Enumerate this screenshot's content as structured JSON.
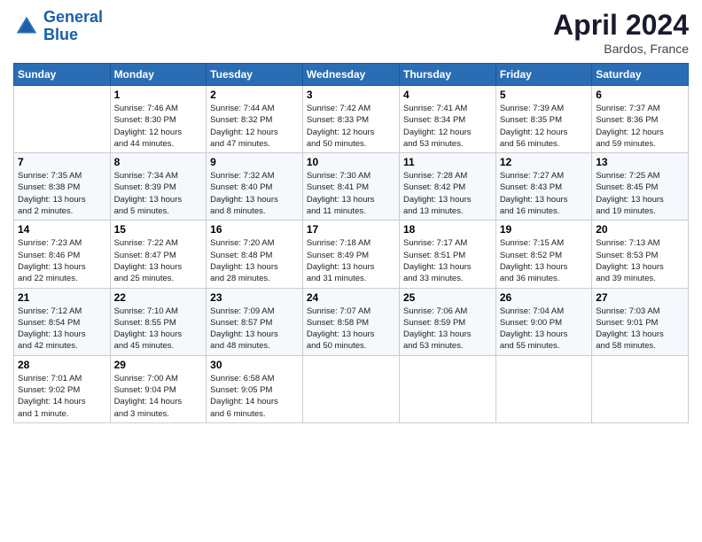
{
  "header": {
    "logo_line1": "General",
    "logo_line2": "Blue",
    "month": "April 2024",
    "location": "Bardos, France"
  },
  "days_of_week": [
    "Sunday",
    "Monday",
    "Tuesday",
    "Wednesday",
    "Thursday",
    "Friday",
    "Saturday"
  ],
  "weeks": [
    [
      {
        "num": "",
        "info": ""
      },
      {
        "num": "1",
        "info": "Sunrise: 7:46 AM\nSunset: 8:30 PM\nDaylight: 12 hours\nand 44 minutes."
      },
      {
        "num": "2",
        "info": "Sunrise: 7:44 AM\nSunset: 8:32 PM\nDaylight: 12 hours\nand 47 minutes."
      },
      {
        "num": "3",
        "info": "Sunrise: 7:42 AM\nSunset: 8:33 PM\nDaylight: 12 hours\nand 50 minutes."
      },
      {
        "num": "4",
        "info": "Sunrise: 7:41 AM\nSunset: 8:34 PM\nDaylight: 12 hours\nand 53 minutes."
      },
      {
        "num": "5",
        "info": "Sunrise: 7:39 AM\nSunset: 8:35 PM\nDaylight: 12 hours\nand 56 minutes."
      },
      {
        "num": "6",
        "info": "Sunrise: 7:37 AM\nSunset: 8:36 PM\nDaylight: 12 hours\nand 59 minutes."
      }
    ],
    [
      {
        "num": "7",
        "info": "Sunrise: 7:35 AM\nSunset: 8:38 PM\nDaylight: 13 hours\nand 2 minutes."
      },
      {
        "num": "8",
        "info": "Sunrise: 7:34 AM\nSunset: 8:39 PM\nDaylight: 13 hours\nand 5 minutes."
      },
      {
        "num": "9",
        "info": "Sunrise: 7:32 AM\nSunset: 8:40 PM\nDaylight: 13 hours\nand 8 minutes."
      },
      {
        "num": "10",
        "info": "Sunrise: 7:30 AM\nSunset: 8:41 PM\nDaylight: 13 hours\nand 11 minutes."
      },
      {
        "num": "11",
        "info": "Sunrise: 7:28 AM\nSunset: 8:42 PM\nDaylight: 13 hours\nand 13 minutes."
      },
      {
        "num": "12",
        "info": "Sunrise: 7:27 AM\nSunset: 8:43 PM\nDaylight: 13 hours\nand 16 minutes."
      },
      {
        "num": "13",
        "info": "Sunrise: 7:25 AM\nSunset: 8:45 PM\nDaylight: 13 hours\nand 19 minutes."
      }
    ],
    [
      {
        "num": "14",
        "info": "Sunrise: 7:23 AM\nSunset: 8:46 PM\nDaylight: 13 hours\nand 22 minutes."
      },
      {
        "num": "15",
        "info": "Sunrise: 7:22 AM\nSunset: 8:47 PM\nDaylight: 13 hours\nand 25 minutes."
      },
      {
        "num": "16",
        "info": "Sunrise: 7:20 AM\nSunset: 8:48 PM\nDaylight: 13 hours\nand 28 minutes."
      },
      {
        "num": "17",
        "info": "Sunrise: 7:18 AM\nSunset: 8:49 PM\nDaylight: 13 hours\nand 31 minutes."
      },
      {
        "num": "18",
        "info": "Sunrise: 7:17 AM\nSunset: 8:51 PM\nDaylight: 13 hours\nand 33 minutes."
      },
      {
        "num": "19",
        "info": "Sunrise: 7:15 AM\nSunset: 8:52 PM\nDaylight: 13 hours\nand 36 minutes."
      },
      {
        "num": "20",
        "info": "Sunrise: 7:13 AM\nSunset: 8:53 PM\nDaylight: 13 hours\nand 39 minutes."
      }
    ],
    [
      {
        "num": "21",
        "info": "Sunrise: 7:12 AM\nSunset: 8:54 PM\nDaylight: 13 hours\nand 42 minutes."
      },
      {
        "num": "22",
        "info": "Sunrise: 7:10 AM\nSunset: 8:55 PM\nDaylight: 13 hours\nand 45 minutes."
      },
      {
        "num": "23",
        "info": "Sunrise: 7:09 AM\nSunset: 8:57 PM\nDaylight: 13 hours\nand 48 minutes."
      },
      {
        "num": "24",
        "info": "Sunrise: 7:07 AM\nSunset: 8:58 PM\nDaylight: 13 hours\nand 50 minutes."
      },
      {
        "num": "25",
        "info": "Sunrise: 7:06 AM\nSunset: 8:59 PM\nDaylight: 13 hours\nand 53 minutes."
      },
      {
        "num": "26",
        "info": "Sunrise: 7:04 AM\nSunset: 9:00 PM\nDaylight: 13 hours\nand 55 minutes."
      },
      {
        "num": "27",
        "info": "Sunrise: 7:03 AM\nSunset: 9:01 PM\nDaylight: 13 hours\nand 58 minutes."
      }
    ],
    [
      {
        "num": "28",
        "info": "Sunrise: 7:01 AM\nSunset: 9:02 PM\nDaylight: 14 hours\nand 1 minute."
      },
      {
        "num": "29",
        "info": "Sunrise: 7:00 AM\nSunset: 9:04 PM\nDaylight: 14 hours\nand 3 minutes."
      },
      {
        "num": "30",
        "info": "Sunrise: 6:58 AM\nSunset: 9:05 PM\nDaylight: 14 hours\nand 6 minutes."
      },
      {
        "num": "",
        "info": ""
      },
      {
        "num": "",
        "info": ""
      },
      {
        "num": "",
        "info": ""
      },
      {
        "num": "",
        "info": ""
      }
    ]
  ]
}
